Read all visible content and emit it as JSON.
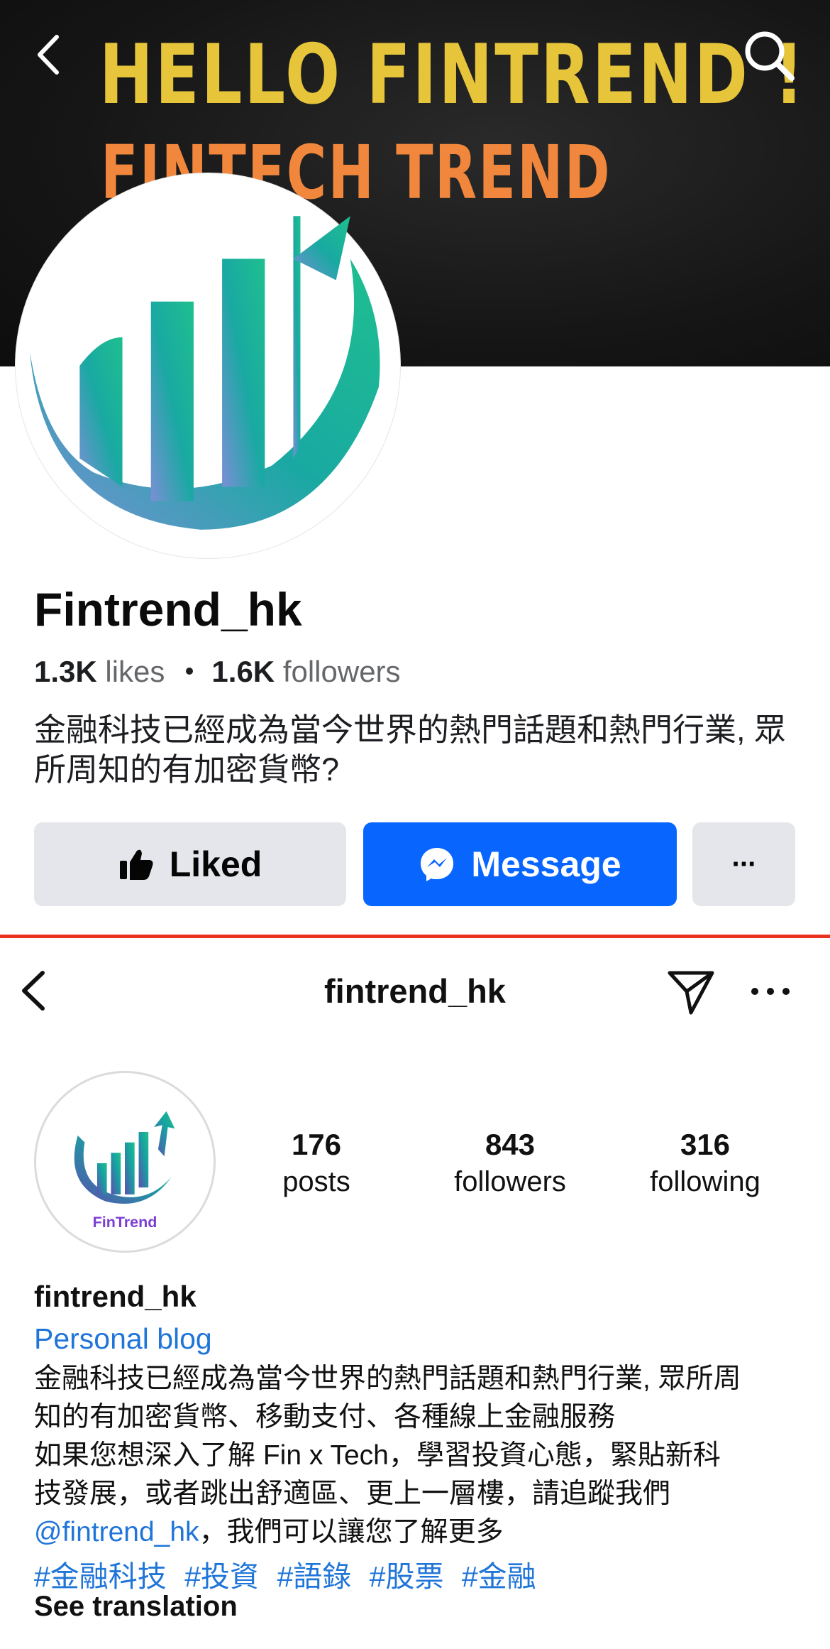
{
  "facebook": {
    "cover": {
      "line1": "HELLO  FINTREND !",
      "line2": "FINTECH TREND"
    },
    "page_name": "Fintrend_hk",
    "likes_count": "1.3K",
    "likes_label": "likes",
    "followers_count": "1.6K",
    "followers_label": "followers",
    "bio": "金融科技已經成為當今世界的熱門話題和熱門行業, 眾所周知的有加密貨幣?",
    "buttons": {
      "liked": "Liked",
      "message": "Message",
      "more": "···"
    },
    "icons": [
      "back-arrow-icon",
      "search-icon",
      "thumbs-up-icon",
      "messenger-icon"
    ],
    "colors": {
      "message_button": "#0866ff",
      "secondary_button": "#e4e6eb",
      "cover_text_yellow": "#e6c53a",
      "cover_text_orange": "#f1873c"
    }
  },
  "divider_color": "#e8321f",
  "instagram": {
    "header_title": "fintrend_hk",
    "avatar_text": "FinTrend",
    "stats": [
      {
        "value": "176",
        "label": "posts"
      },
      {
        "value": "843",
        "label": "followers"
      },
      {
        "value": "316",
        "label": "following"
      }
    ],
    "username": "fintrend_hk",
    "category": "Personal blog",
    "bio_line1": "金融科技已經成為當今世界的熱門話題和熱門行業, 眾所周",
    "bio_line2": "知的有加密貨幣、移動支付、各種線上金融服務",
    "bio_line3": "如果您想深入了解 Fin x Tech，學習投資心態，緊貼新科",
    "bio_line4": "技發展，或者跳出舒適區、更上一層樓，請追蹤我們",
    "bio_mention": "@fintrend_hk",
    "bio_line5_rest": "，我們可以讓您了解更多",
    "hashtags": [
      "#金融科技",
      "#投資",
      "#語錄",
      "#股票",
      "#金融"
    ],
    "see_translation": "See translation",
    "icons": [
      "back-chevron-icon",
      "send-icon",
      "more-icon"
    ],
    "colors": {
      "link": "#1f75d8"
    }
  }
}
